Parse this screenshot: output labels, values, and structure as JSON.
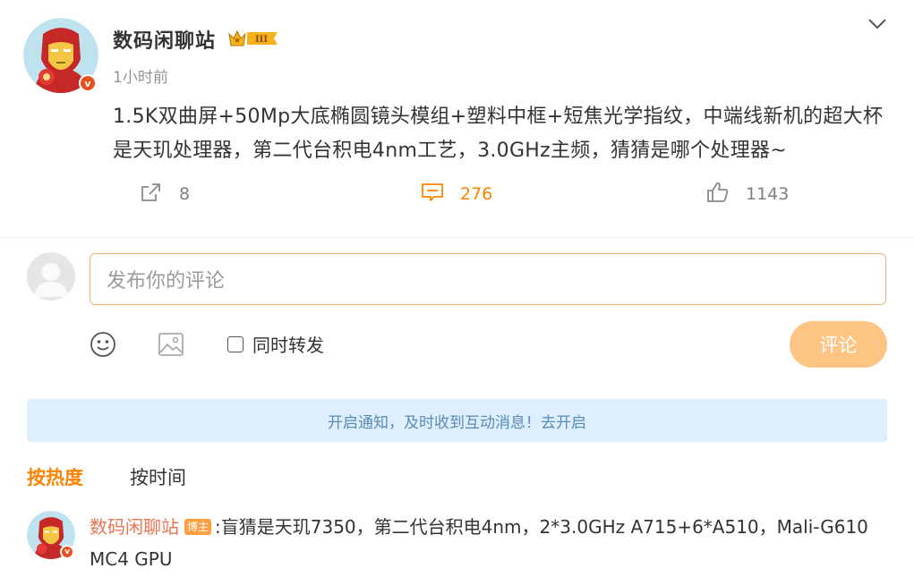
{
  "post": {
    "author": "数码闲聊站",
    "level_badge": "III",
    "time": "1小时前",
    "content": "1.5K双曲屏+50Mp大底椭圆镜头模组+塑料中框+短焦光学指纹，中端线新机的超大杯是天玑处理器，第二代台积电4nm工艺，3.0GHz主频，猜猜是哪个处理器~",
    "verified_mark": "v"
  },
  "actions": {
    "share_count": "8",
    "comment_count": "276",
    "like_count": "1143"
  },
  "composer": {
    "placeholder": "发布你的评论",
    "sync_label": "同时转发",
    "submit_label": "评论"
  },
  "notice": {
    "text": "开启通知，及时收到互动消息！去开启"
  },
  "sort": {
    "hot": "按热度",
    "time": "按时间"
  },
  "reply": {
    "author": "数码闲聊站",
    "tag": "博主",
    "text": ":盲猜是天玑7350，第二代台积电4nm，2*3.0GHz A715+6*A510，Mali-G610 MC4 GPU"
  },
  "colors": {
    "accent": "#ff8200",
    "link": "#eb7350",
    "submit_disabled": "#fdc483",
    "notice_bg": "#ddeefc",
    "notice_text": "#5b8bb5",
    "verified": "#e8501d"
  },
  "icons": [
    "iron-man-avatar",
    "crown-level-badge",
    "chevron-down-icon",
    "share-icon",
    "comment-icon",
    "like-icon",
    "emoji-icon",
    "image-icon",
    "default-avatar"
  ]
}
